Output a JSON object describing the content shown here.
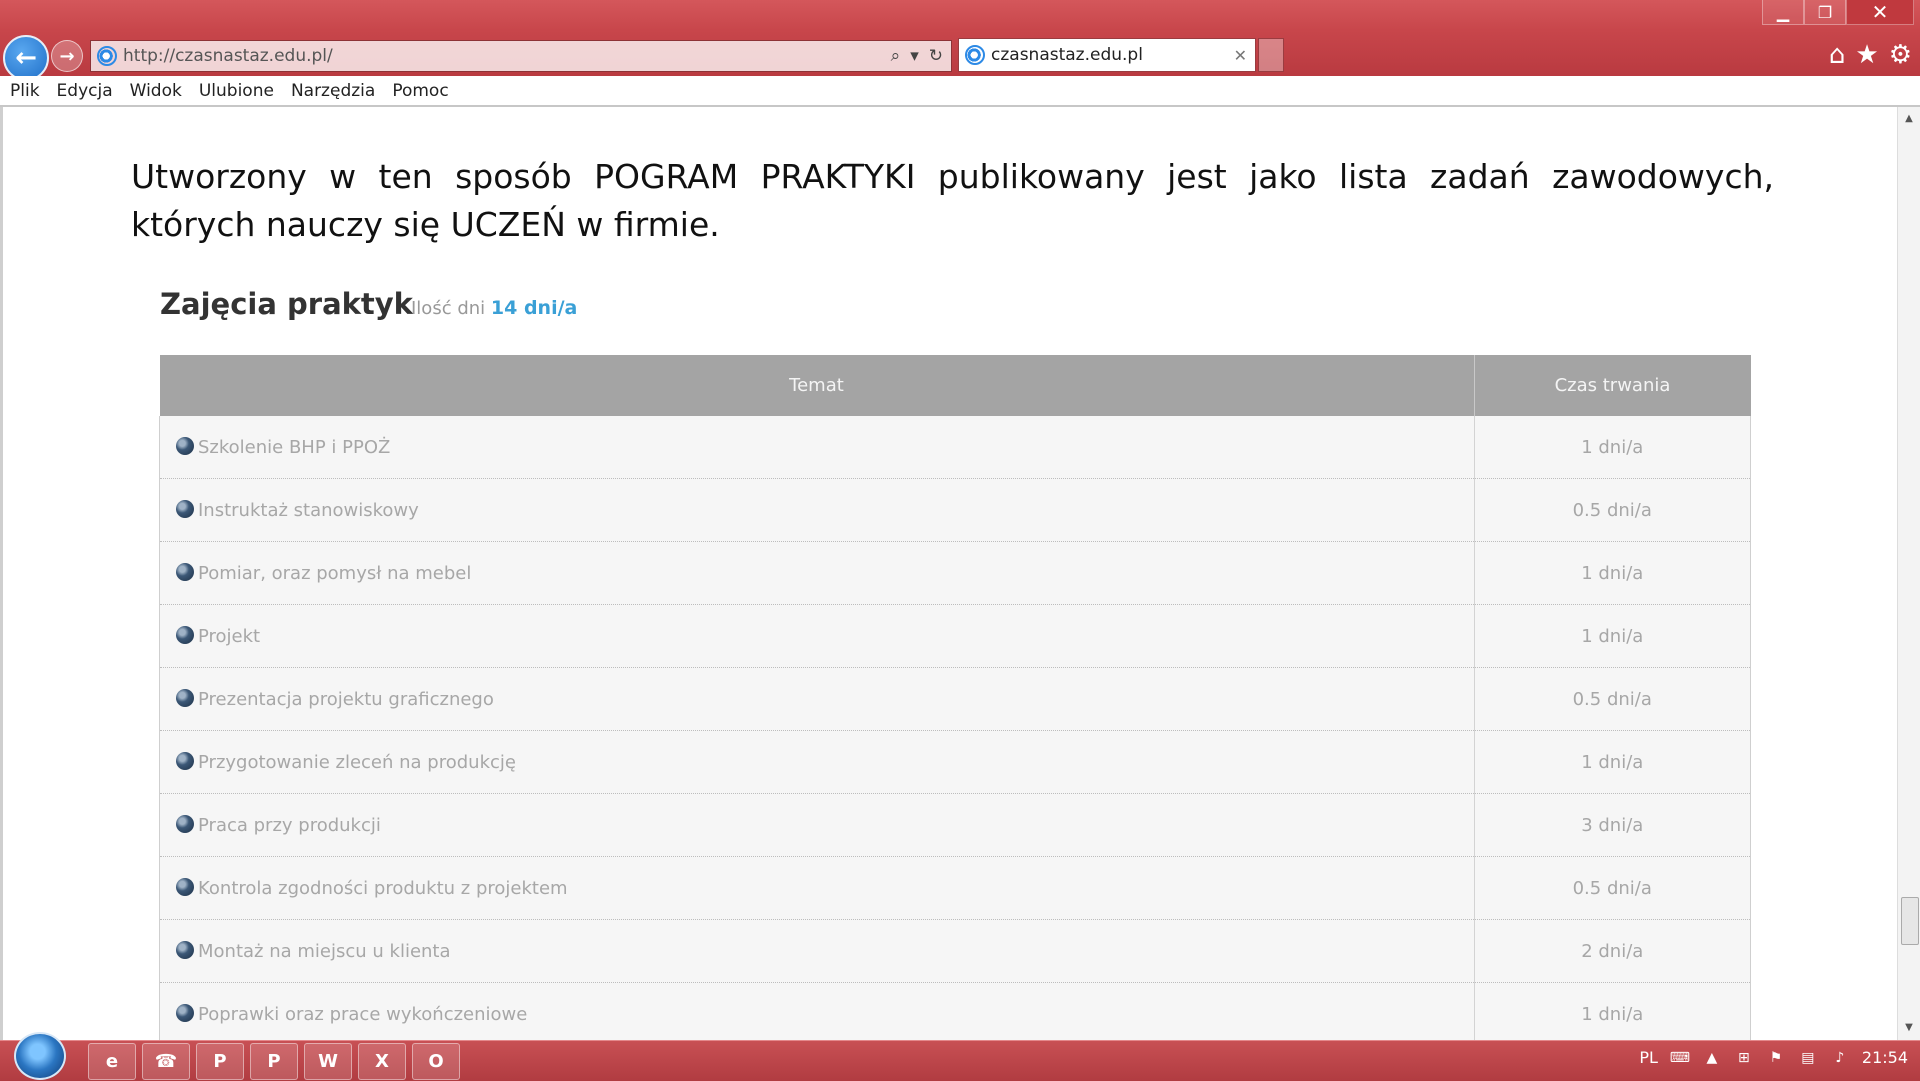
{
  "browser": {
    "url": "http://czasnastaz.edu.pl/",
    "tab_title": "czasnastaz.edu.pl",
    "menu": [
      "Plik",
      "Edycja",
      "Widok",
      "Ulubione",
      "Narzędzia",
      "Pomoc"
    ]
  },
  "page": {
    "intro_text": "Utworzony w ten sposób POGRAM PRAKTYKI publikowany jest jako lista zadań zawodowych, których nauczy się UCZEŃ w firmie.",
    "section_title": "Zajęcia praktyk",
    "days_label": "Ilość dni",
    "days_value": "14 dni/a",
    "table": {
      "headers": [
        "Temat",
        "Czas trwania"
      ],
      "rows": [
        {
          "topic": "Szkolenie BHP i PPOŻ",
          "duration": "1 dni/a"
        },
        {
          "topic": "Instruktaż stanowiskowy",
          "duration": "0.5 dni/a"
        },
        {
          "topic": "Pomiar, oraz pomysł na mebel",
          "duration": "1 dni/a"
        },
        {
          "topic": "Projekt",
          "duration": "1 dni/a"
        },
        {
          "topic": "Prezentacja projektu graficznego",
          "duration": "0.5 dni/a"
        },
        {
          "topic": "Przygotowanie zleceń na produkcję",
          "duration": "1 dni/a"
        },
        {
          "topic": "Praca przy produkcji",
          "duration": "3 dni/a"
        },
        {
          "topic": "Kontrola zgodności produktu z projektem",
          "duration": "0.5 dni/a"
        },
        {
          "topic": "Montaż na miejscu u klienta",
          "duration": "2 dni/a"
        },
        {
          "topic": "Poprawki oraz prace wykończeniowe",
          "duration": "1 dni/a"
        }
      ]
    }
  },
  "taskbar": {
    "language": "PL",
    "clock": "21:54",
    "apps": [
      "internet-explorer-icon",
      "outlook-contacts-icon",
      "publisher-icon",
      "powerpoint-icon",
      "word-icon",
      "excel-icon",
      "outlook-icon"
    ]
  },
  "colors": {
    "chrome_red": "#c8464b",
    "table_header": "#a4a4a4",
    "days_accent": "#3aa0d6"
  }
}
